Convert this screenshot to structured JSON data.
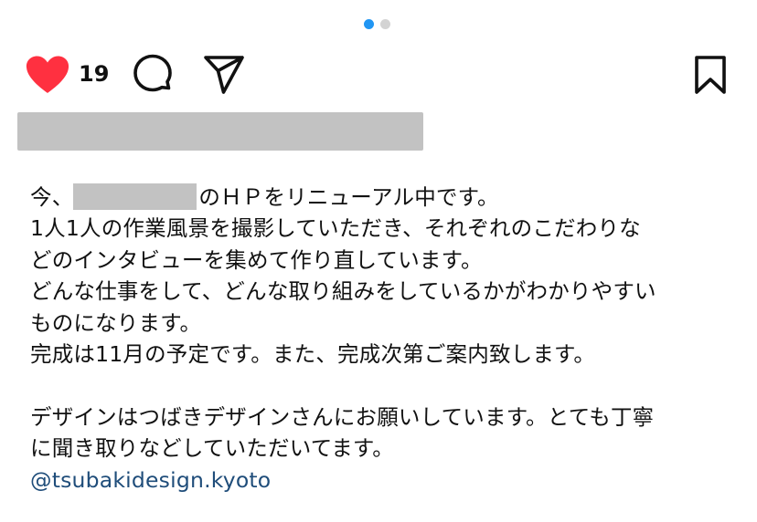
{
  "carousel": {
    "total": 2,
    "active_index": 0,
    "active_color": "#2196f3",
    "inactive_color": "#d3d3d3"
  },
  "actions": {
    "like_count": "19",
    "liked": true,
    "like_color": "#ff3040",
    "icons": [
      "heart-icon",
      "comment-icon",
      "share-icon",
      "bookmark-icon"
    ]
  },
  "caption": {
    "line1_prefix": "今、",
    "line1_suffix": "のＨＰをリニューアル中です。",
    "line2": "1人1人の作業風景を撮影していただき、それぞれのこだわりな",
    "line3": "どのインタビューを集めて作り直しています。",
    "line4": "どんな仕事をして、どんな取り組みをしているかがわかりやすい",
    "line5": "ものになります。",
    "line6": "完成は11月の予定です。また、完成次第ご案内致します。",
    "line7": "デザインはつばきデザインさんにお願いしています。とても丁寧",
    "line8": "に聞き取りなどしていただいてます。",
    "mention": "@tsubakidesign.kyoto",
    "mention_color": "#1f4d7a"
  }
}
